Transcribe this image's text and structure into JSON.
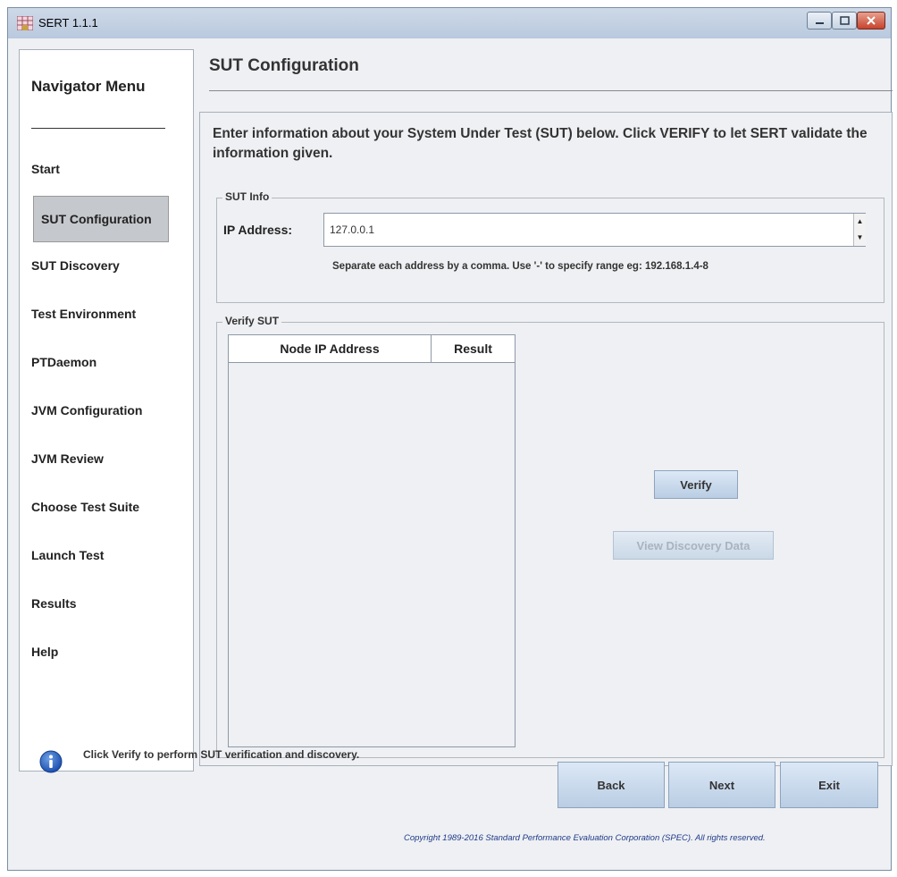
{
  "window": {
    "title": "SERT 1.1.1"
  },
  "nav": {
    "title": "Navigator Menu",
    "items": [
      {
        "label": "Start"
      },
      {
        "label": "SUT Configuration"
      },
      {
        "label": "SUT Discovery"
      },
      {
        "label": "Test Environment"
      },
      {
        "label": "PTDaemon"
      },
      {
        "label": "JVM Configuration"
      },
      {
        "label": "JVM Review"
      },
      {
        "label": "Choose Test Suite"
      },
      {
        "label": "Launch Test"
      },
      {
        "label": "Results"
      },
      {
        "label": "Help"
      }
    ],
    "active": "SUT Configuration"
  },
  "page": {
    "title": "SUT Configuration",
    "intro": "Enter information about your System Under Test (SUT) below. Click VERIFY to let SERT validate the information given."
  },
  "sut_info": {
    "group_label": "SUT Info",
    "ip_label": "IP Address:",
    "ip_value": "127.0.0.1",
    "hint": "Separate each address by a comma. Use '-' to specify range eg: 192.168.1.4-8"
  },
  "verify": {
    "group_label": "Verify SUT",
    "columns": [
      "Node IP Address",
      "Result"
    ],
    "rows": [],
    "verify_button": "Verify",
    "view_button": "View Discovery Data"
  },
  "footer": {
    "status": "Click Verify to perform SUT verification and discovery.",
    "back": "Back",
    "next": "Next",
    "exit": "Exit",
    "copyright": "Copyright 1989-2016 Standard Performance Evaluation Corporation (SPEC). All rights reserved."
  }
}
